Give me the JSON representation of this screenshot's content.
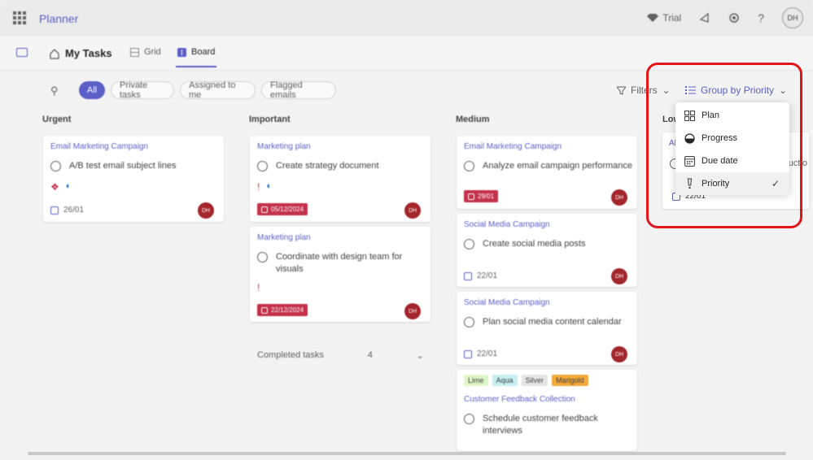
{
  "app": {
    "title": "Planner"
  },
  "topbar": {
    "trial_label": "Trial",
    "avatar_initials": "DH"
  },
  "header": {
    "title": "My Tasks",
    "tabs": [
      {
        "label": "Grid"
      },
      {
        "label": "Board"
      }
    ]
  },
  "filters": {
    "pills": [
      {
        "label": "All"
      },
      {
        "label": "Private tasks"
      },
      {
        "label": "Assigned to me"
      },
      {
        "label": "Flagged emails"
      }
    ],
    "filters_label": "Filters",
    "group_by_label": "Group by Priority"
  },
  "columns": [
    {
      "title": "Urgent"
    },
    {
      "title": "Important"
    },
    {
      "title": "Medium"
    },
    {
      "title": "Low"
    }
  ],
  "cards": {
    "urgent1": {
      "plan": "Email Marketing Campaign",
      "task": "A/B test email subject lines",
      "due": "26/01",
      "avatar": "DH"
    },
    "important1": {
      "plan": "Marketing plan",
      "task": "Create strategy document",
      "due": "05/12/2024",
      "avatar": "DH"
    },
    "important2": {
      "plan": "Marketing plan",
      "task": "Coordinate with design team for visuals",
      "due": "22/12/2024",
      "avatar": "DH"
    },
    "medium1": {
      "plan": "Email Marketing Campaign",
      "task": "Analyze email campaign performance",
      "due": "29/01",
      "avatar": "DH"
    },
    "medium2": {
      "plan": "Social Media Campaign",
      "task": "Create social media posts",
      "due": "22/01",
      "avatar": "DH"
    },
    "medium3": {
      "plan": "Social Media Campaign",
      "task": "Plan social media content calendar",
      "due": "22/01",
      "avatar": "DH"
    },
    "medium4": {
      "labels": [
        "Lime",
        "Aqua",
        "Silver",
        "Marigold"
      ],
      "plan": "Customer Feedback Collection",
      "task": "Schedule customer feedback interviews"
    },
    "low1": {
      "plan": "Al",
      "task_fragment": "uctio",
      "due": "22/01"
    }
  },
  "completed": {
    "label": "Completed tasks",
    "count": "4"
  },
  "groupby_menu": {
    "items": [
      {
        "label": "Plan",
        "icon": "grid-icon"
      },
      {
        "label": "Progress",
        "icon": "half-circle-icon"
      },
      {
        "label": "Due date",
        "icon": "calendar-icon"
      },
      {
        "label": "Priority",
        "icon": "priority-icon",
        "selected": true
      }
    ]
  },
  "colors": {
    "accent": "#5b5fc7",
    "urgent": "#c4314b",
    "highlight": "#e0161b"
  }
}
